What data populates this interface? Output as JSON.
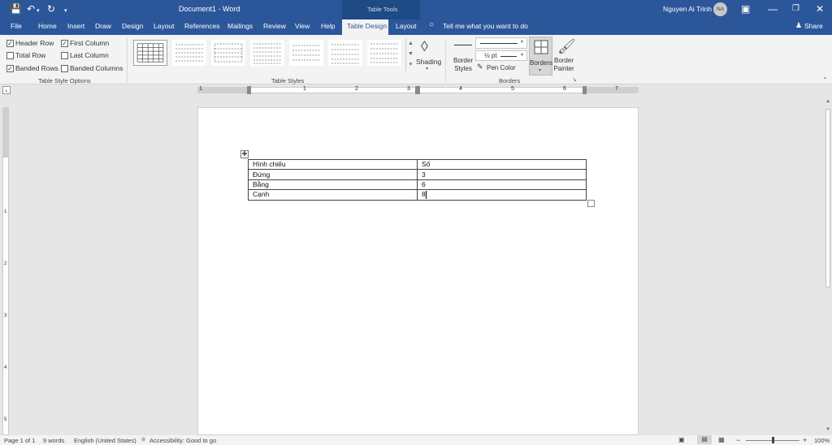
{
  "titlebar": {
    "doc_title": "Document1  -  Word",
    "context": "Table Tools",
    "user": "Nguyen Ai Trinh",
    "initials": "NA"
  },
  "tabs": [
    "File",
    "Home",
    "Insert",
    "Draw",
    "Design",
    "Layout",
    "References",
    "Mailings",
    "Review",
    "View",
    "Help",
    "Table Design",
    "Layout"
  ],
  "active_tab": "Table Design",
  "tell_me": "Tell me what you want to do",
  "share": "Share",
  "style_options": {
    "items": [
      {
        "label": "Header Row",
        "checked": true
      },
      {
        "label": "First Column",
        "checked": true
      },
      {
        "label": "Total Row",
        "checked": false
      },
      {
        "label": "Last Column",
        "checked": false
      },
      {
        "label": "Banded Rows",
        "checked": true
      },
      {
        "label": "Banded Columns",
        "checked": false
      }
    ],
    "group_label": "Table Style Options"
  },
  "table_styles": {
    "group_label": "Table Styles",
    "shading": "Shading"
  },
  "borders": {
    "border_styles": "Border Styles",
    "weight": "½ pt",
    "pen_color": "Pen Color",
    "borders_btn": "Borders",
    "border_painter": "Border Painter",
    "group_label": "Borders"
  },
  "ruler": [
    "1",
    "1",
    "2",
    "3",
    "4",
    "5",
    "6",
    "7"
  ],
  "vruler": [
    "1",
    "2",
    "3",
    "4",
    "5"
  ],
  "document": {
    "table": [
      [
        "Hình chiếu",
        "Số"
      ],
      [
        "Đứng",
        "3"
      ],
      [
        "Bằng",
        "6"
      ],
      [
        "Cạnh",
        "8"
      ]
    ]
  },
  "status": {
    "page": "Page 1 of 1",
    "words": "9 words",
    "lang": "English (United States)",
    "access": "Accessibility: Good to go",
    "zoom": "100%"
  },
  "colors": {
    "brand": "#2b579a",
    "ribbon": "#f3f3f3"
  }
}
